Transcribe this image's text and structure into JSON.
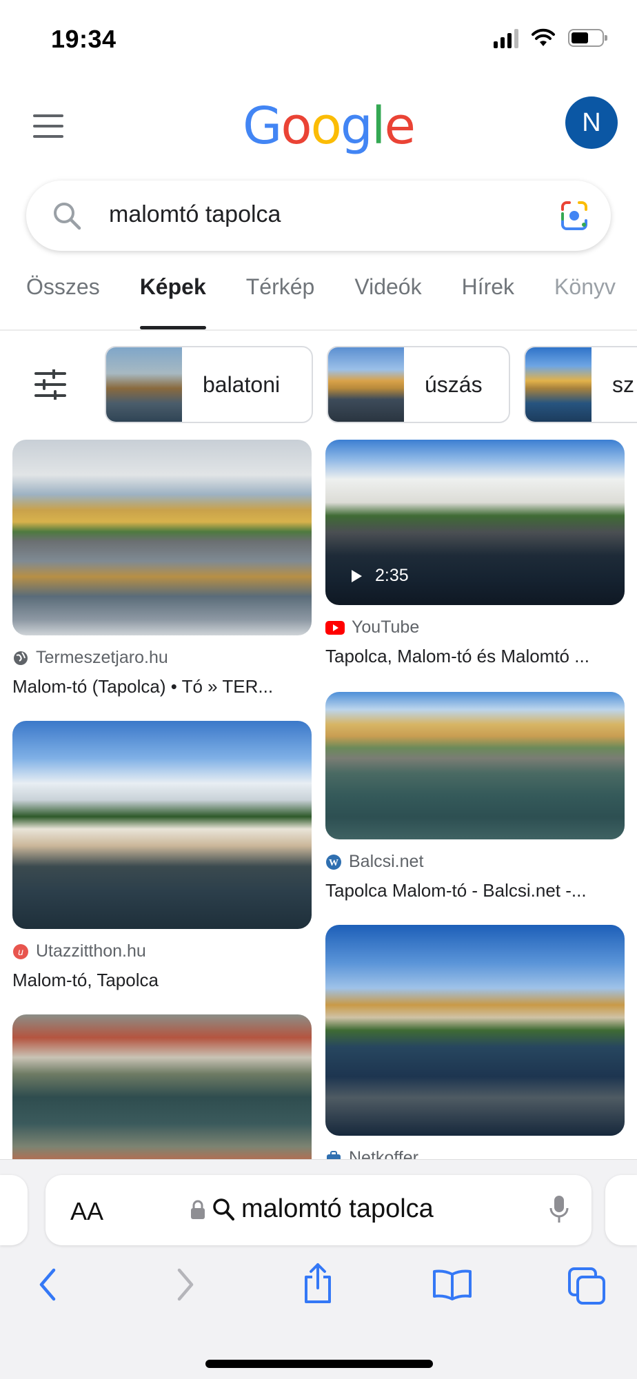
{
  "status_bar": {
    "time": "19:34"
  },
  "header": {
    "logo": "Google",
    "avatar_letter": "N"
  },
  "search": {
    "query": "malomtó tapolca"
  },
  "tabs": [
    {
      "label": "Összes",
      "active": false
    },
    {
      "label": "Képek",
      "active": true
    },
    {
      "label": "Térkép",
      "active": false
    },
    {
      "label": "Videók",
      "active": false
    },
    {
      "label": "Hírek",
      "active": false
    },
    {
      "label": "Könyv",
      "active": false
    }
  ],
  "chips": [
    "balatoni",
    "úszás",
    "sz"
  ],
  "results": {
    "left": [
      {
        "source": "Termeszetjaro.hu",
        "title": "Malom-tó (Tapolca) • Tó » TER..."
      },
      {
        "source": "Utazzitthon.hu",
        "title": "Malom-tó, Tapolca"
      },
      {
        "source": "",
        "title": ""
      }
    ],
    "right": [
      {
        "source": "YouTube",
        "title": "Tapolca, Malom-tó és Malomtó ...",
        "duration": "2:35"
      },
      {
        "source": "Balcsi.net",
        "title": "Tapolca Malom-tó - Balcsi.net -..."
      },
      {
        "source": "Netkoffer",
        "title": ""
      }
    ]
  },
  "safari": {
    "text_size_label": "AA",
    "address": "malomtó tapolca"
  },
  "icons": {
    "menu": "hamburger-icon",
    "search": "search-icon",
    "lens": "google-lens-icon",
    "filter": "tune-icon",
    "play": "play-icon",
    "lock": "lock-icon",
    "mic": "microphone-icon",
    "back": "back-icon",
    "forward": "forward-icon",
    "share": "share-icon",
    "bookmarks": "bookmarks-icon",
    "tabs": "tabs-icon"
  },
  "colors": {
    "google_blue": "#4285F4",
    "google_red": "#EA4335",
    "google_yellow": "#FBBC05",
    "google_green": "#34A853",
    "safari_blue": "#3478F6",
    "avatar_bg": "#0B57A4"
  }
}
